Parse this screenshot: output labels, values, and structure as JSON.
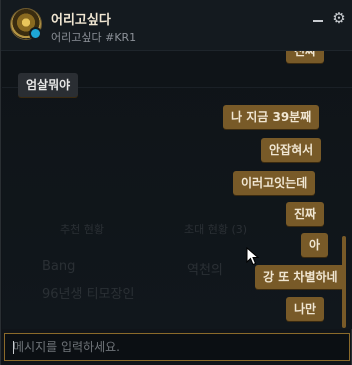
{
  "header": {
    "name": "어리고싶다",
    "tag": "어리고싶다 #KR1",
    "status_color": "#1ea7d6",
    "avatar_icon": "summoner-icon",
    "minimize_icon": "minimize-icon",
    "settings_icon": "gear-icon"
  },
  "background": {
    "recommend_label": "추천 현황",
    "invite_label": "초대 현황 (3)",
    "player_name": "Bang",
    "player_desc": "96년생 티모장인",
    "invite_name": "역천의"
  },
  "messages": [
    {
      "dir": "out",
      "text": "진짜"
    },
    {
      "dir": "in",
      "text": "엄살뭐야"
    },
    {
      "dir": "out",
      "text": "나 지금 39분째"
    },
    {
      "dir": "out",
      "text": "안잡혀서"
    },
    {
      "dir": "out",
      "text": "이러고잇는데"
    },
    {
      "dir": "out",
      "text": "진짜"
    },
    {
      "dir": "out",
      "text": "아"
    },
    {
      "dir": "out",
      "text": "강 또 차별하네"
    },
    {
      "dir": "out",
      "text": "나만"
    }
  ],
  "input": {
    "placeholder": "메시지를 입력하세요."
  },
  "colors": {
    "outgoing_bubble": "#785a28",
    "incoming_bubble": "#2a2e33",
    "input_border": "#8b6a2a"
  }
}
